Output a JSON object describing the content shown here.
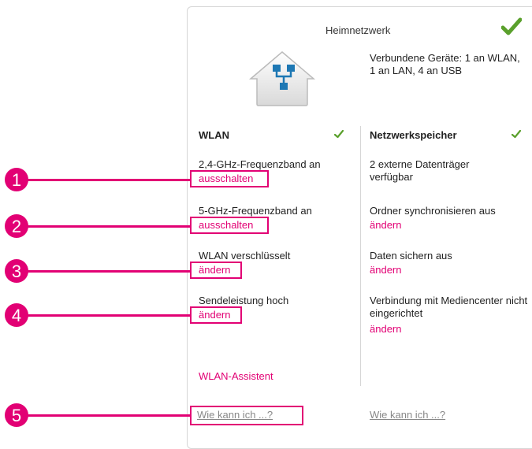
{
  "header": {
    "title": "Heimnetzwerk",
    "status_icon": "check-icon"
  },
  "devices": {
    "text": "Verbundene Geräte: 1 an WLAN, 1 an LAN, 4 an USB"
  },
  "wlan": {
    "title": "WLAN",
    "items": [
      {
        "text": "2,4-GHz-Frequenzband an",
        "link": "ausschalten"
      },
      {
        "text": "5-GHz-Frequenzband an",
        "link": "ausschalten"
      },
      {
        "text": "WLAN verschlüsselt",
        "link": "ändern"
      },
      {
        "text": "Sendeleistung hoch",
        "link": "ändern"
      }
    ],
    "assistant": "WLAN-Assistent",
    "help": "Wie kann ich ...?"
  },
  "nas": {
    "title": "Netzwerkspeicher",
    "items": [
      {
        "text": "2 externe Datenträger verfügbar"
      },
      {
        "text": "Ordner synchronisieren aus",
        "link": "ändern"
      },
      {
        "text": "Daten sichern aus",
        "link": "ändern"
      },
      {
        "text": "Verbindung mit Mediencenter nicht eingerichtet",
        "link": "ändern"
      }
    ],
    "help": "Wie kann ich ...?"
  },
  "callouts": [
    "1",
    "2",
    "3",
    "4",
    "5"
  ],
  "colors": {
    "accent": "#e20074",
    "check": "#5aa02c",
    "border": "#d6d6d6"
  }
}
